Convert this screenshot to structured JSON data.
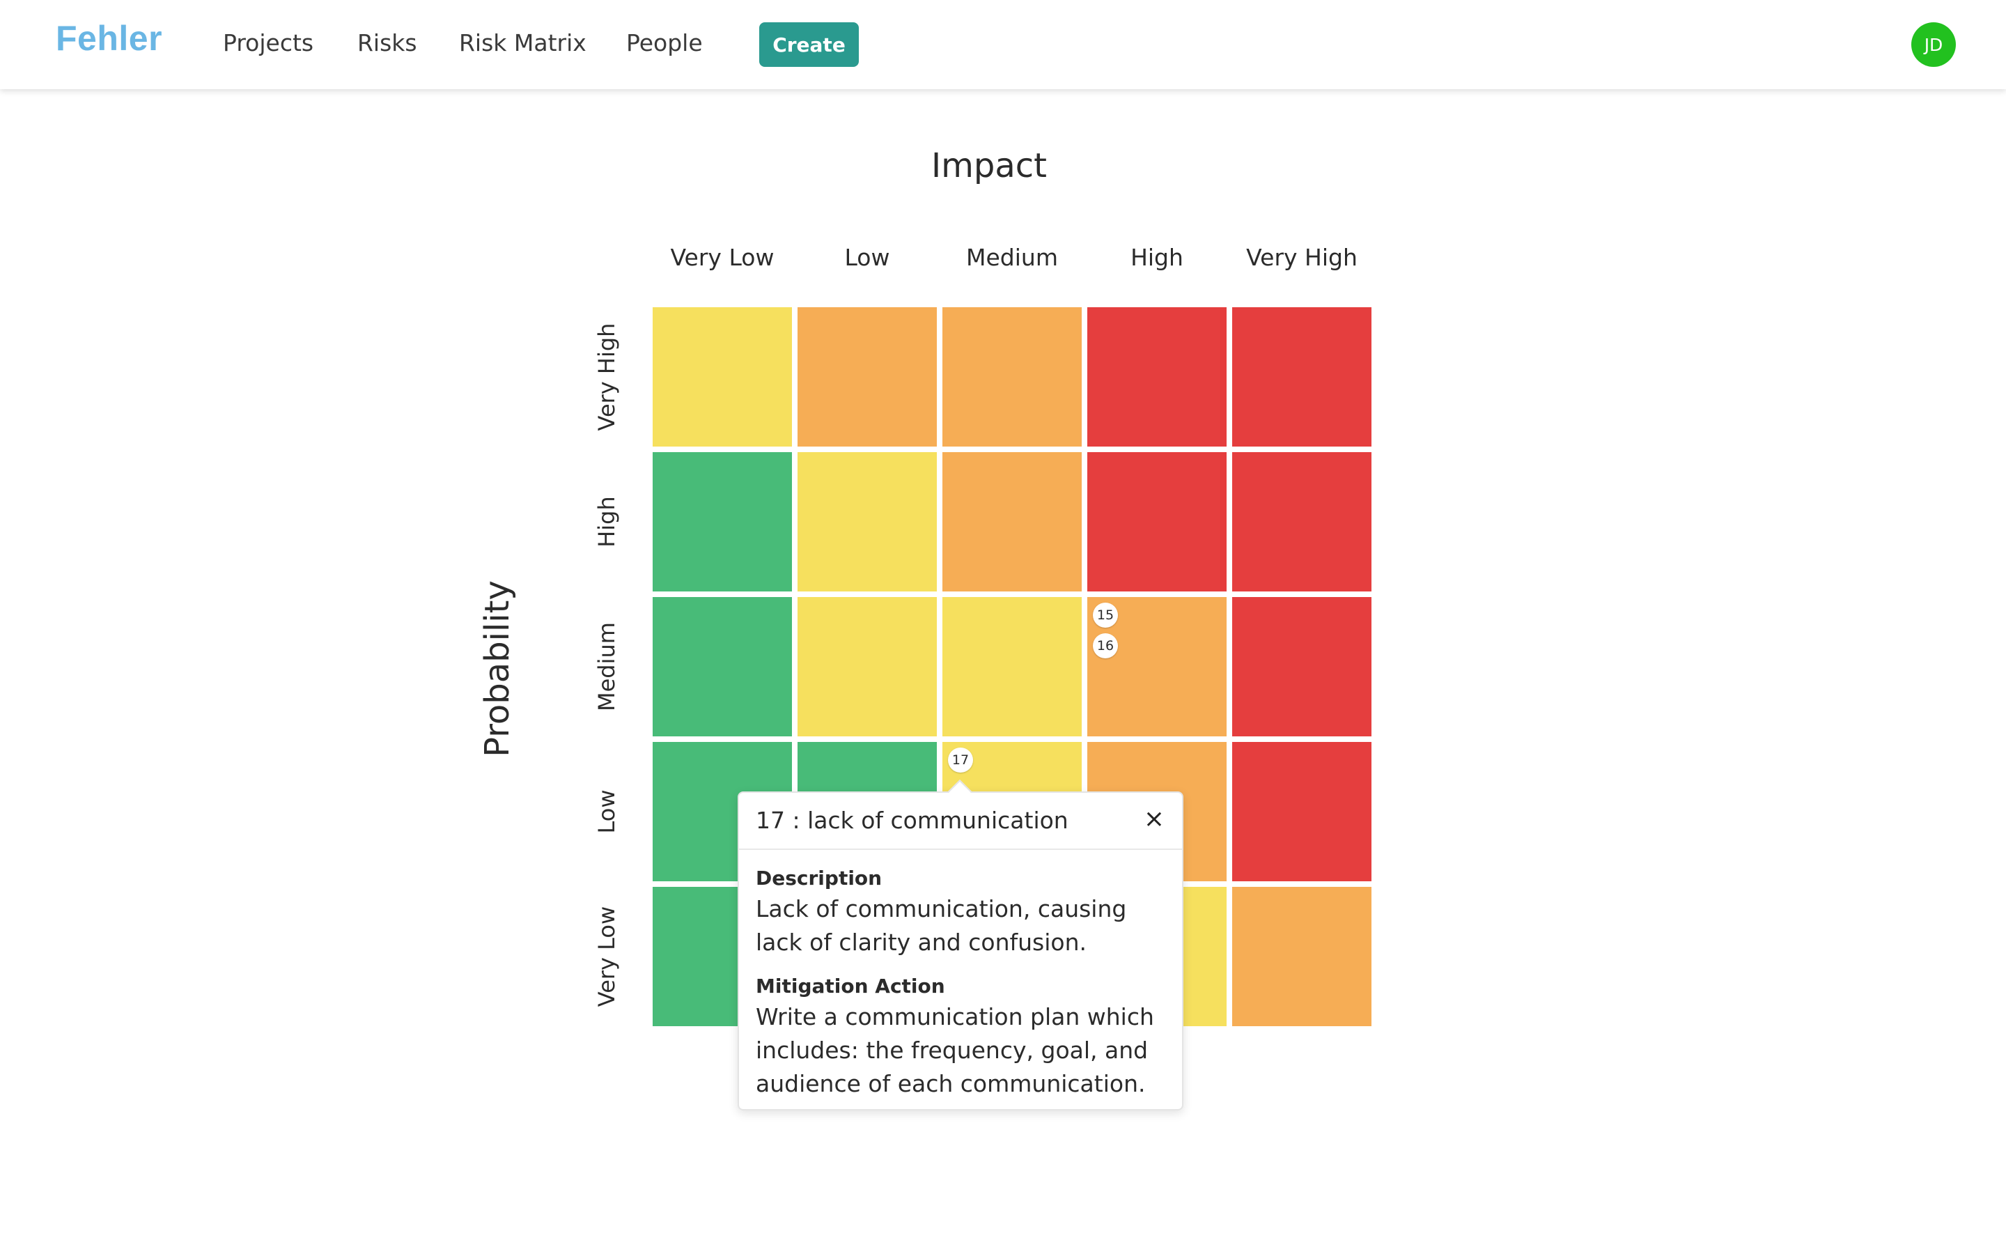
{
  "nav": {
    "brand": "Fehler",
    "links": [
      "Projects",
      "Risks",
      "Risk Matrix",
      "People"
    ],
    "create_label": "Create",
    "user_initials": "JD"
  },
  "matrix": {
    "x_title": "Impact",
    "y_title": "Probability",
    "columns": [
      "Very Low",
      "Low",
      "Medium",
      "High",
      "Very High"
    ],
    "rows": [
      "Very High",
      "High",
      "Medium",
      "Low",
      "Very Low"
    ],
    "colors": {
      "green": "#48bb78",
      "yellow": "#f6e05e",
      "orange": "#f6ad55",
      "red": "#e53e3e"
    },
    "cell_colors": [
      [
        "yellow",
        "orange",
        "orange",
        "red",
        "red"
      ],
      [
        "green",
        "yellow",
        "orange",
        "red",
        "red"
      ],
      [
        "green",
        "yellow",
        "yellow",
        "orange",
        "red"
      ],
      [
        "green",
        "green",
        "yellow",
        "orange",
        "red"
      ],
      [
        "green",
        "green",
        "yellow",
        "yellow",
        "orange"
      ]
    ],
    "risks": [
      {
        "id": "15",
        "probability": "Medium",
        "impact": "High"
      },
      {
        "id": "16",
        "probability": "Medium",
        "impact": "High"
      },
      {
        "id": "17",
        "probability": "Low",
        "impact": "Medium"
      }
    ]
  },
  "popover": {
    "title": "17 : lack of communication",
    "close_icon": "×",
    "description_label": "Description",
    "description": "Lack of communication, causing lack of clarity and confusion.",
    "mitigation_label": "Mitigation Action",
    "mitigation": "Write a communication plan which includes: the frequency, goal, and audience of each communication."
  }
}
